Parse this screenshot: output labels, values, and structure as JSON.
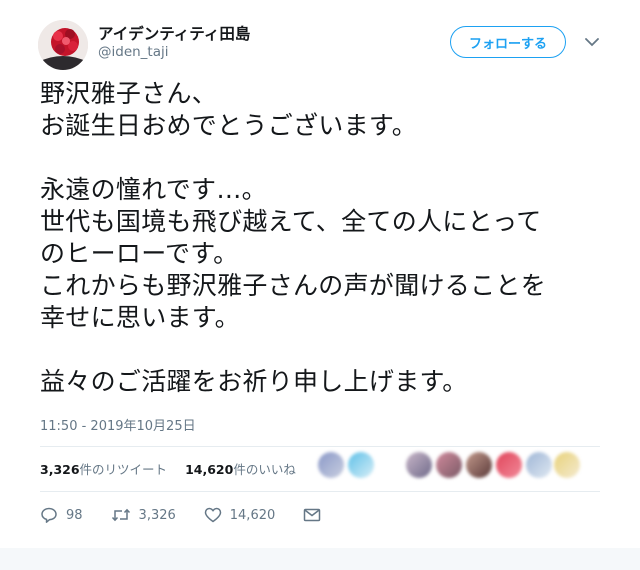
{
  "user": {
    "display_name": "アイデンティティ田島",
    "handle": "@iden_taji",
    "follow_label": "フォローする"
  },
  "tweet": {
    "lines": [
      "野沢雅子さん、",
      "お誕生日おめでとうございます。",
      "",
      "永遠の憧れです…。",
      "世代も国境も飛び越えて、全ての人にとって",
      "のヒーローです。",
      "これからも野沢雅子さんの声が聞けることを",
      "幸せに思います。",
      "",
      "益々のご活躍をお祈り申し上げます。"
    ],
    "timestamp": "11:50 - 2019年10月25日"
  },
  "stats": {
    "retweet_count": "3,326",
    "retweet_label": "件のリツイート",
    "like_count": "14,620",
    "like_label": "件のいいね"
  },
  "actions": {
    "replies": "98",
    "retweets": "3,326",
    "likes": "14,620"
  },
  "colors": {
    "accent": "#1da1f2",
    "text": "#14171a",
    "muted": "#657786"
  }
}
